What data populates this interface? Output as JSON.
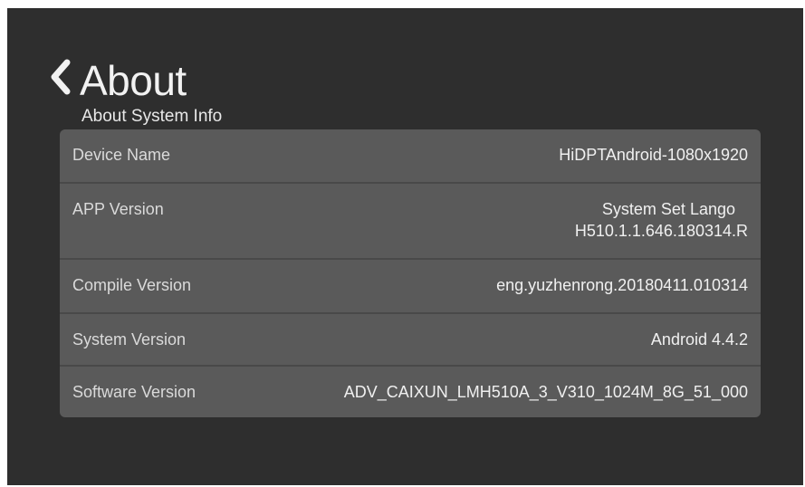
{
  "header": {
    "back_icon": "chevron-left-icon",
    "title": "About",
    "subtitle": "About System Info"
  },
  "info": {
    "rows": [
      {
        "label": "Device Name",
        "value": [
          "HiDPTAndroid-1080x1920"
        ]
      },
      {
        "label": "APP Version",
        "value": [
          "System Set Lango",
          "H510.1.1.646.180314.R"
        ]
      },
      {
        "label": "Compile Version",
        "value": [
          "eng.yuzhenrong.20180411.010314"
        ]
      },
      {
        "label": "System Version",
        "value": [
          "Android 4.4.2"
        ]
      },
      {
        "label": "Software Version",
        "value": [
          "ADV_CAIXUN_LMH510A_3_V310_1024M_8G_51_000"
        ]
      }
    ]
  },
  "colors": {
    "background": "#2e2e2e",
    "panel": "#5a5a5a",
    "divider": "#494949",
    "text": "#f0f0f0"
  }
}
